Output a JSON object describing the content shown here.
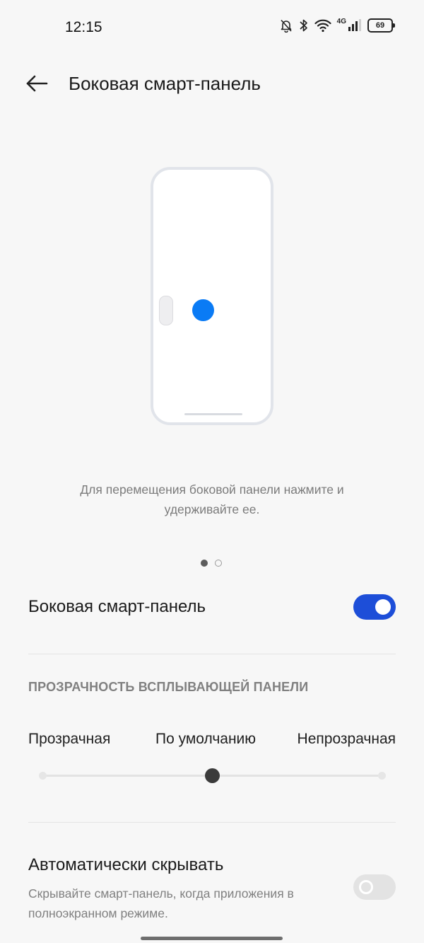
{
  "status": {
    "time": "12:15",
    "network": "4G",
    "battery": "69",
    "icons": [
      "bell-off-icon",
      "bluetooth-icon",
      "wifi-icon",
      "signal-icon",
      "battery-icon"
    ]
  },
  "header": {
    "title": "Боковая смарт-панель",
    "back_icon": "arrow-left-icon"
  },
  "illustration": {
    "accent_color": "#0a7bf5",
    "page_index": 1,
    "page_count": 2
  },
  "caption": "Для перемещения боковой панели нажмите и удерживайте ее.",
  "smart_panel": {
    "label": "Боковая смарт-панель",
    "enabled": true,
    "toggle_color": "#1d4ed8"
  },
  "transparency": {
    "header": "ПРОЗРАЧНОСТЬ ВСПЛЫВАЮЩЕЙ ПАНЕЛИ",
    "options": [
      "Прозрачная",
      "По умолчанию",
      "Непрозрачная"
    ],
    "selected_index": 1,
    "selected_fraction": 0.5
  },
  "auto_hide": {
    "title": "Автоматически скрывать",
    "description": "Скрывайте смарт-панель, когда приложения в полноэкранном режиме.",
    "enabled": false
  }
}
